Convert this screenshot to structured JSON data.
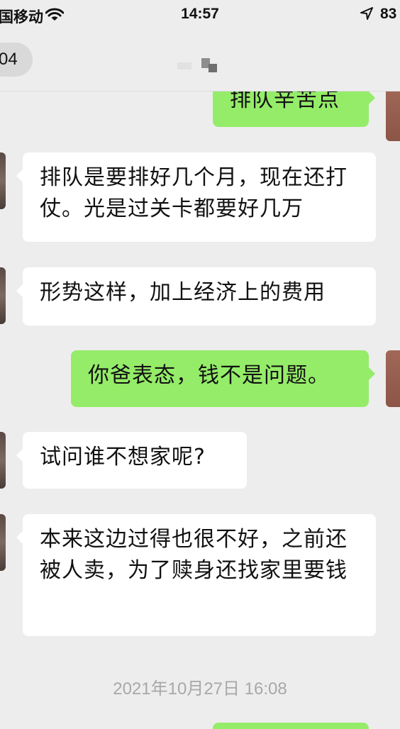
{
  "status_bar": {
    "carrier": "国移动",
    "time": "14:57",
    "battery": "83"
  },
  "nav": {
    "back_count": "04"
  },
  "messages": [
    {
      "side": "right",
      "text": "排队辛苦点"
    },
    {
      "side": "left",
      "text": "排队是要排好几个月，现在还打仗。光是过关卡都要好几万"
    },
    {
      "side": "left",
      "text": "形势这样，加上经济上的费用"
    },
    {
      "side": "right",
      "text": "你爸表态，钱不是问题。"
    },
    {
      "side": "left",
      "text": "试问谁不想家呢?"
    },
    {
      "side": "left",
      "text": "本来这边过得也很不好，之前还被人卖，为了赎身还找家里要钱"
    }
  ],
  "timestamp": "2021年10月27日 16:08",
  "colors": {
    "background": "#ededed",
    "incoming_bubble": "#ffffff",
    "outgoing_bubble": "#95ec69",
    "timestamp_text": "#a8a8a8"
  }
}
